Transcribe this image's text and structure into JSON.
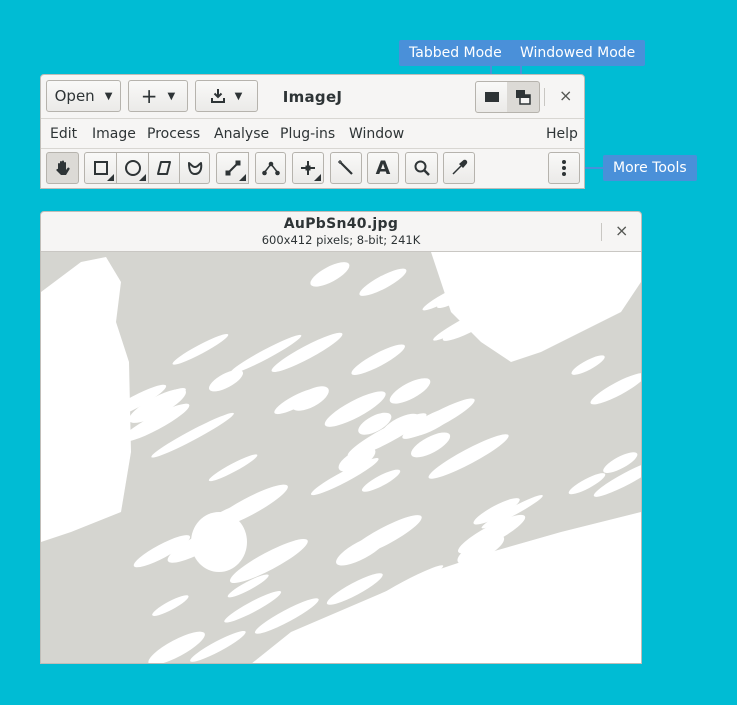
{
  "annotations": {
    "tabbed_mode": "Tabbed Mode",
    "windowed_mode": "Windowed Mode",
    "more_tools": "More Tools",
    "color": "#4a90d9"
  },
  "main_window": {
    "title": "ImageJ",
    "open_label": "Open",
    "new_label": "+",
    "save_icon": "download-icon",
    "tabbed_icon": "tabbed-window-icon",
    "windowed_icon": "windowed-stack-icon",
    "close_icon": "close-icon",
    "close_glyph": "×"
  },
  "menu": {
    "items": [
      "Edit",
      "Image",
      "Process",
      "Analyse",
      "Plug-ins",
      "Window"
    ],
    "help": "Help"
  },
  "toolbar": {
    "tools": [
      {
        "name": "hand-tool",
        "icon": "hand-icon"
      },
      {
        "name": "rectangle-tool",
        "icon": "rectangle-icon"
      },
      {
        "name": "oval-tool",
        "icon": "oval-icon"
      },
      {
        "name": "polygon-tool",
        "icon": "polygon-icon"
      },
      {
        "name": "freehand-tool",
        "icon": "freehand-icon"
      },
      {
        "name": "line-tool",
        "icon": "line-icon"
      },
      {
        "name": "angle-tool",
        "icon": "angle-icon"
      },
      {
        "name": "point-tool",
        "icon": "crosshair-icon"
      },
      {
        "name": "wand-tool",
        "icon": "wand-icon"
      },
      {
        "name": "text-tool",
        "icon": "text-icon"
      },
      {
        "name": "zoom-tool",
        "icon": "magnifier-icon"
      },
      {
        "name": "color-picker-tool",
        "icon": "dropper-icon"
      },
      {
        "name": "more-tools",
        "icon": "vertical-dots-icon"
      }
    ],
    "text_tool_glyph": "A"
  },
  "image_window": {
    "filename": "AuPbSn40.jpg",
    "info": "600x412 pixels; 8-bit; 241K",
    "close_glyph": "×",
    "background_color": "#d5d5d0",
    "foreground_color": "#ffffff"
  }
}
